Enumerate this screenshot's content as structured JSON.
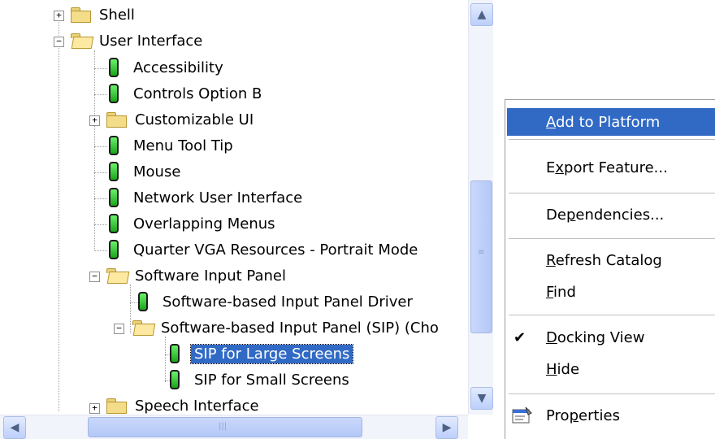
{
  "tree": {
    "items": [
      {
        "label": "Shell",
        "type": "folder",
        "expander": "+"
      },
      {
        "label": "User Interface",
        "type": "folder-open",
        "expander": "−"
      },
      {
        "label": "Accessibility",
        "type": "component"
      },
      {
        "label": "Controls Option B",
        "type": "component"
      },
      {
        "label": "Customizable UI",
        "type": "folder",
        "expander": "+"
      },
      {
        "label": "Menu Tool Tip",
        "type": "component"
      },
      {
        "label": "Mouse",
        "type": "component"
      },
      {
        "label": "Network User Interface",
        "type": "component"
      },
      {
        "label": "Overlapping Menus",
        "type": "component"
      },
      {
        "label": "Quarter VGA Resources - Portrait Mode",
        "type": "component"
      },
      {
        "label": "Software Input Panel",
        "type": "folder-open",
        "expander": "−"
      },
      {
        "label": "Software-based Input Panel Driver",
        "type": "component"
      },
      {
        "label": "Software-based Input Panel (SIP) (Cho",
        "type": "folder-open",
        "expander": "−"
      },
      {
        "label": "SIP for Large Screens",
        "type": "component",
        "selected": true
      },
      {
        "label": "SIP for Small Screens",
        "type": "component"
      },
      {
        "label": "Speech Interface",
        "type": "folder",
        "expander": "+"
      }
    ]
  },
  "scrollbars": {
    "vertical": {
      "up": "▲",
      "down": "▼",
      "grip": "≡",
      "position": 0.6
    },
    "horizontal": {
      "left": "◀",
      "right": "▶",
      "grip": "|||"
    }
  },
  "context_menu": {
    "items": [
      {
        "pre": "",
        "key": "A",
        "post": "dd to Platform",
        "highlighted": true
      },
      {
        "pre": "E",
        "key": "x",
        "post": "port Feature..."
      },
      {
        "pre": "De",
        "key": "p",
        "post": "endencies..."
      },
      {
        "pre": "",
        "key": "R",
        "post": "efresh Catalog"
      },
      {
        "pre": "",
        "key": "F",
        "post": "ind"
      },
      {
        "pre": "",
        "key": "D",
        "post": "ocking View",
        "checked": true,
        "check": "✔"
      },
      {
        "pre": "",
        "key": "H",
        "post": "ide"
      },
      {
        "pre": "Pro",
        "key": "p",
        "post": "erties"
      }
    ]
  },
  "colors": {
    "selection": "#316ac5",
    "scroll_track": "#f2f4fb",
    "folder": "#f3dc8a",
    "component": "#1aa51a"
  }
}
